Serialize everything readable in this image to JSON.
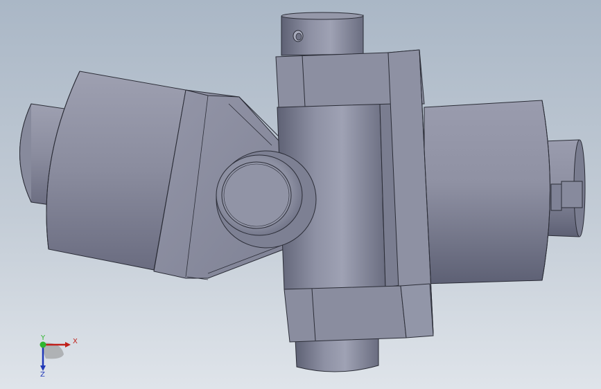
{
  "viewport": {
    "background_top": "#aab7c6",
    "background_bottom": "#dfe4ea",
    "part_color": "#8a8ea0"
  },
  "model": {
    "icon": "universal-joint-model"
  },
  "triad": {
    "x_label": "X",
    "y_label": "Y",
    "z_label": "Z",
    "x_color": "#c0201a",
    "y_color": "#2fb52f",
    "z_color": "#2038b8"
  }
}
